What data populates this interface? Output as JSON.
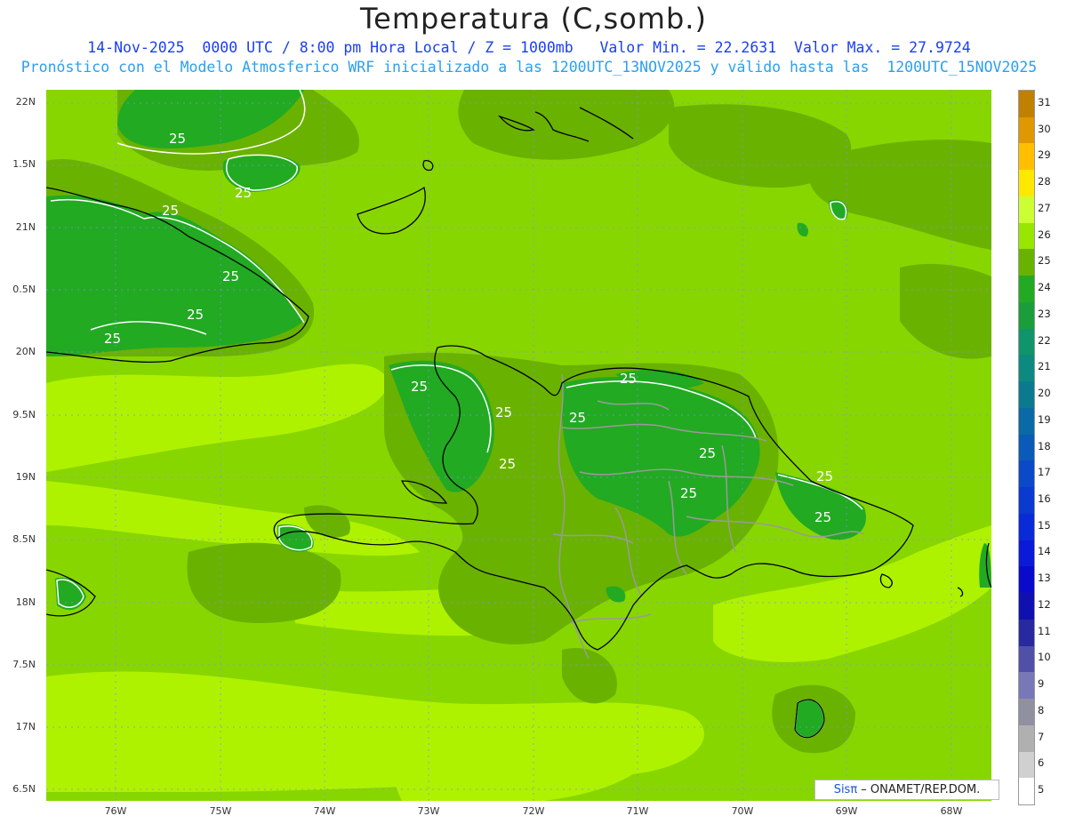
{
  "title": "Temperatura (C,somb.)",
  "subtitle_line1": "14-Nov-2025  0000 UTC / 8:00 pm Hora Local / Z = 1000mb   Valor Min. = 22.2631  Valor Max. = 27.9724",
  "subtitle_line2": "Pronóstico con el Modelo Atmosferico WRF inicializado a las 1200UTC_13NOV2025 y válido hasta las  1200UTC_15NOV2025",
  "lat_labels": [
    "22N",
    "1.5N",
    "21N",
    "0.5N",
    "20N",
    "9.5N",
    "19N",
    "8.5N",
    "18N",
    "7.5N",
    "17N",
    "6.5N"
  ],
  "lon_labels": [
    "76W",
    "75W",
    "74W",
    "73W",
    "72W",
    "71W",
    "70W",
    "69W",
    "68W"
  ],
  "colorbar": {
    "labels": [
      "31",
      "30",
      "29",
      "28",
      "27",
      "26",
      "25",
      "24",
      "23",
      "22",
      "21",
      "20",
      "19",
      "18",
      "17",
      "16",
      "15",
      "14",
      "13",
      "12",
      "11",
      "10",
      "9",
      "8",
      "7",
      "6",
      "5"
    ],
    "colors": [
      "#c08000",
      "#e09800",
      "#ffbf00",
      "#ffe800",
      "#ccff33",
      "#99e600",
      "#6ab200",
      "#22aa22",
      "#1a9e3c",
      "#10956a",
      "#0d8a80",
      "#0b7a8f",
      "#0a6aa5",
      "#0a5ab8",
      "#0a4ac8",
      "#0a3ad0",
      "#0a2ad8",
      "#0a1ad8",
      "#0a0acc",
      "#1010b0",
      "#2828a0",
      "#5050a8",
      "#7878b8",
      "#9090a0",
      "#b0b0b0",
      "#d0d0d0",
      "#ffffff"
    ]
  },
  "contour_label": "25",
  "credit": {
    "brand": "Sisπ",
    "rest": " – ONAMET/REP.DOM."
  }
}
